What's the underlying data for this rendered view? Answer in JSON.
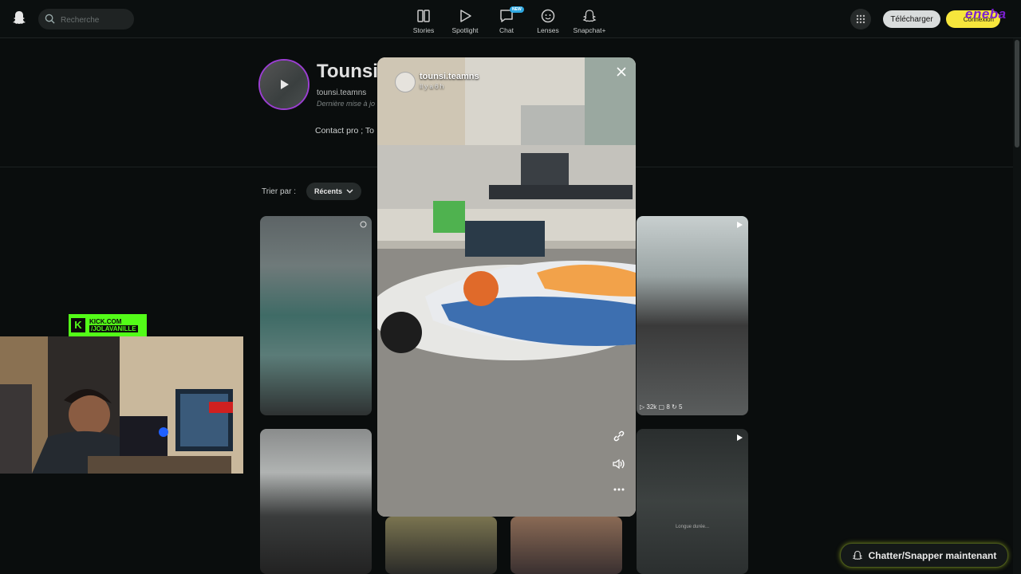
{
  "search": {
    "placeholder": "Recherche"
  },
  "nav": [
    {
      "label": "Stories",
      "icon": "stories-icon"
    },
    {
      "label": "Spotlight",
      "icon": "play-icon"
    },
    {
      "label": "Chat",
      "icon": "chat-icon",
      "badge": "NEW"
    },
    {
      "label": "Lenses",
      "icon": "lens-icon"
    },
    {
      "label": "Snapchat+",
      "icon": "ghost-plus-icon"
    }
  ],
  "header": {
    "download_label": "Télécharger",
    "login_label": "Connexion",
    "ad_text": "eneba"
  },
  "profile": {
    "title": "Tounsi",
    "handle": "tounsi.teamns",
    "updated": "Dernière mise à jo",
    "bio": "Contact pro ; To"
  },
  "sort": {
    "label": "Trier par :",
    "value": "Récents"
  },
  "story_modal": {
    "username": "tounsi.teamns",
    "time": "Il y a 6 h"
  },
  "thumb_stats": {
    "views": "32k",
    "comments": "8",
    "shares": "5"
  },
  "thumb_caption": "Longue durée...",
  "overlay": {
    "kick_line1": "KICK.COM",
    "kick_line2": "/JOLAVANILLE"
  },
  "cta": {
    "label": "Chatter/Snapper maintenant"
  },
  "colors": {
    "accent": "#f7e63c",
    "ring": "#9b3fd1",
    "kick": "#53fc18"
  }
}
